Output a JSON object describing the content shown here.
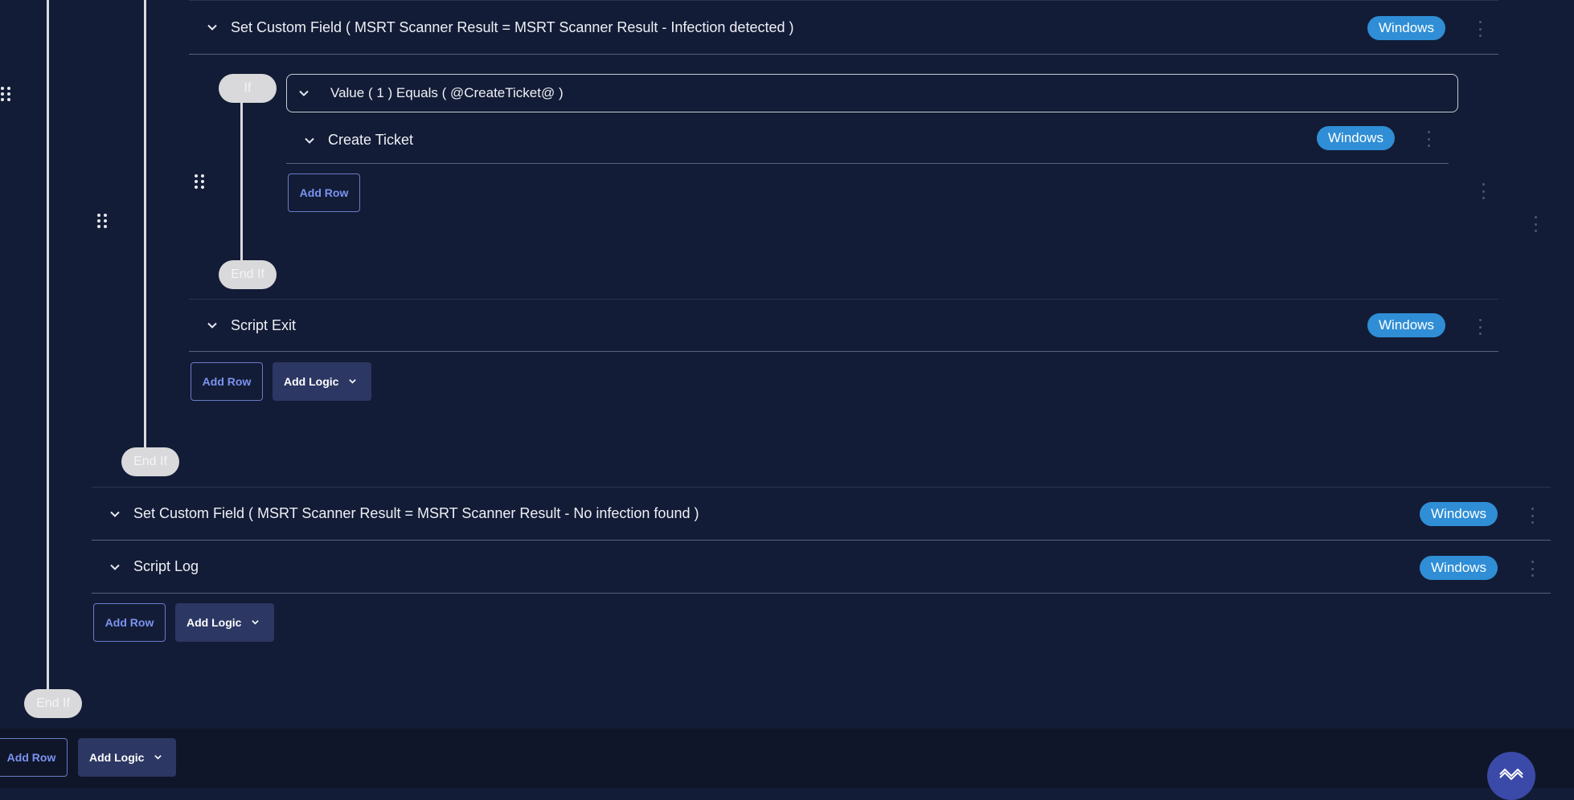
{
  "platform_badge": "Windows",
  "if_label": "If",
  "end_if_label": "End If",
  "add_row_label": "Add Row",
  "add_logic_label": "Add Logic",
  "rows": {
    "set_field_infection": "Set Custom Field ( MSRT Scanner Result = MSRT Scanner Result - Infection detected )",
    "condition": "Value ( 1 ) Equals ( @CreateTicket@ )",
    "create_ticket": "Create Ticket",
    "script_exit": "Script Exit",
    "set_field_no_infection": "Set Custom Field ( MSRT Scanner Result = MSRT Scanner Result - No infection found )",
    "script_log": "Script Log"
  },
  "colors": {
    "background": "#131c36",
    "badge": "#2f8ed6",
    "add_logic_bg": "#2c3763",
    "add_row_text": "#7c93f0",
    "pill": "#d9d9dc"
  },
  "icons": [
    "chevron-down-icon",
    "kebab-menu-icon",
    "drag-handle-icon",
    "help-widget-icon"
  ]
}
